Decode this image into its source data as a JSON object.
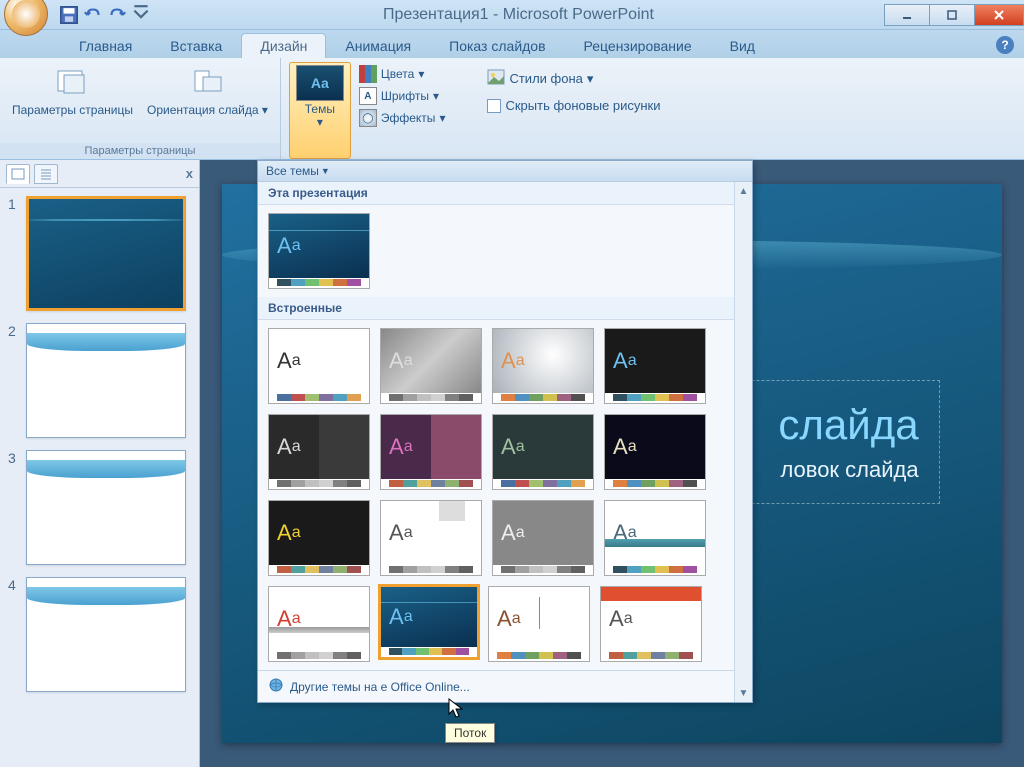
{
  "title": "Презентация1 - Microsoft PowerPoint",
  "tabs": {
    "home": "Главная",
    "insert": "Вставка",
    "design": "Дизайн",
    "animation": "Анимация",
    "slideshow": "Показ слайдов",
    "review": "Рецензирование",
    "view": "Вид"
  },
  "ribbon": {
    "page_group_label": "Параметры страницы",
    "page_setup": "Параметры страницы",
    "orientation": "Ориентация слайда",
    "themes_btn": "Темы",
    "colors": "Цвета",
    "fonts": "Шрифты",
    "effects": "Эффекты",
    "bg_styles": "Стили фона",
    "hide_bg": "Скрыть фоновые рисунки"
  },
  "gallery": {
    "all_themes": "Все темы",
    "this_presentation": "Эта презентация",
    "builtin": "Встроенные",
    "more_online": "Другие темы на             e Office Online...",
    "tooltip": "Поток"
  },
  "thumbs": {
    "n1": "1",
    "n2": "2",
    "n3": "3",
    "n4": "4"
  },
  "slide": {
    "title_fragment": "слайда",
    "subtitle_fragment": "ловок слайда"
  }
}
